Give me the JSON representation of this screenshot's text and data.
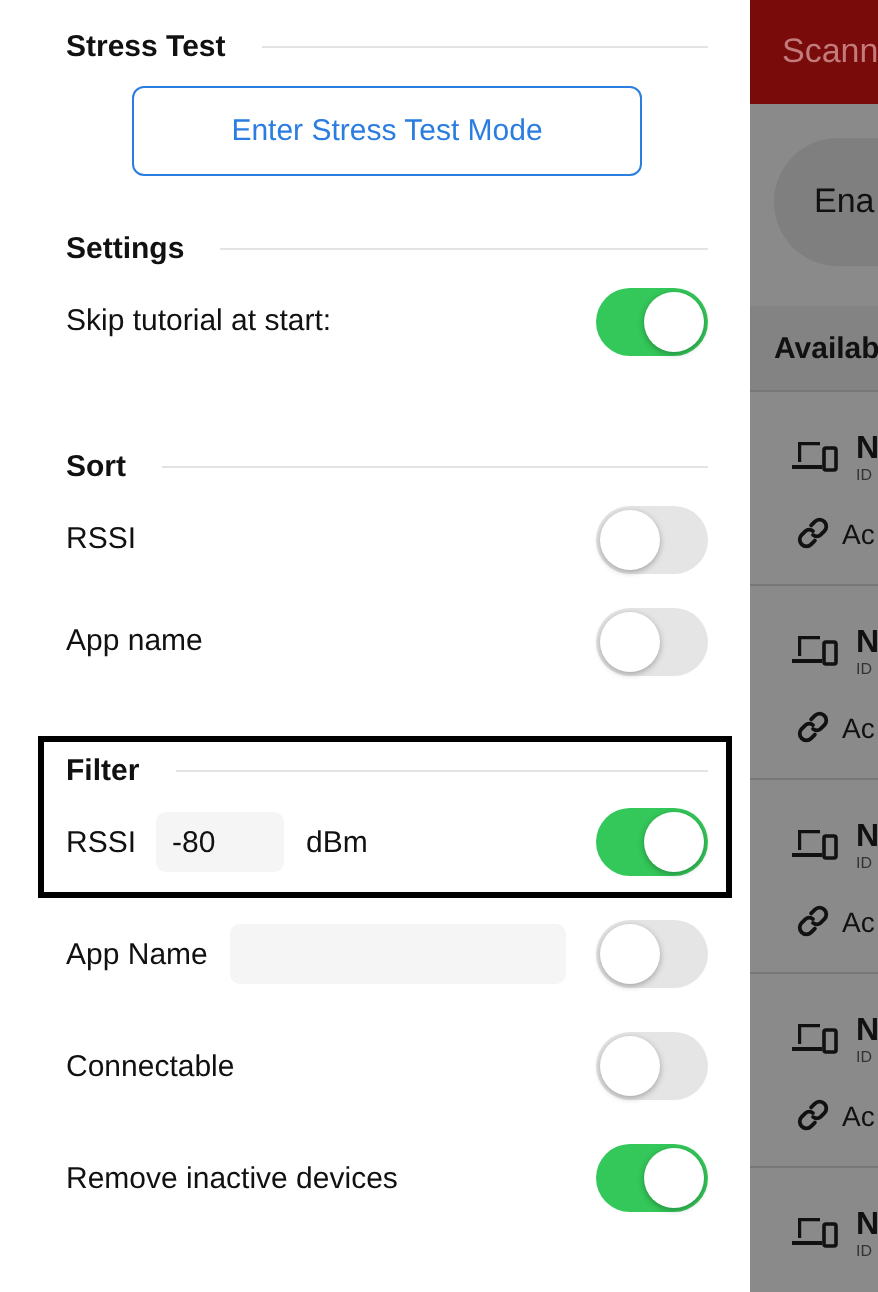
{
  "settings_panel": {
    "sections": [
      {
        "title": "Stress Test",
        "highlighted": false,
        "items": [
          {
            "kind": "button",
            "label": "Enter Stress Test Mode"
          }
        ]
      },
      {
        "title": "Settings",
        "highlighted": false,
        "items": [
          {
            "kind": "toggle",
            "label": "Skip tutorial at start:",
            "on": true
          }
        ]
      },
      {
        "title": "Sort",
        "highlighted": false,
        "items": [
          {
            "kind": "toggle",
            "label": "RSSI",
            "on": false
          },
          {
            "kind": "toggle",
            "label": "App name",
            "on": false
          }
        ]
      },
      {
        "title": "Filter",
        "highlighted": true,
        "items": [
          {
            "kind": "rssi",
            "label": "RSSI",
            "value": "-80",
            "unit": "dBm",
            "on": true
          }
        ]
      },
      {
        "highlighted": false,
        "items": [
          {
            "kind": "text-filter",
            "label": "App Name",
            "on": false
          },
          {
            "kind": "toggle",
            "label": "Connectable",
            "on": false
          },
          {
            "kind": "toggle",
            "label": "Remove inactive devices",
            "on": true
          }
        ]
      }
    ]
  },
  "background_screen": {
    "title": "Scann",
    "button": "Ena",
    "section_header": "Availab",
    "devices": [
      {
        "name": "N",
        "id": "ID",
        "action": "Ac"
      },
      {
        "name": "N",
        "id": "ID",
        "action": "Ac"
      },
      {
        "name": "N",
        "id": "ID",
        "action": "Ac"
      },
      {
        "name": "N",
        "id": "ID",
        "action": "Ac"
      },
      {
        "name": "N",
        "id": "ID"
      }
    ]
  }
}
